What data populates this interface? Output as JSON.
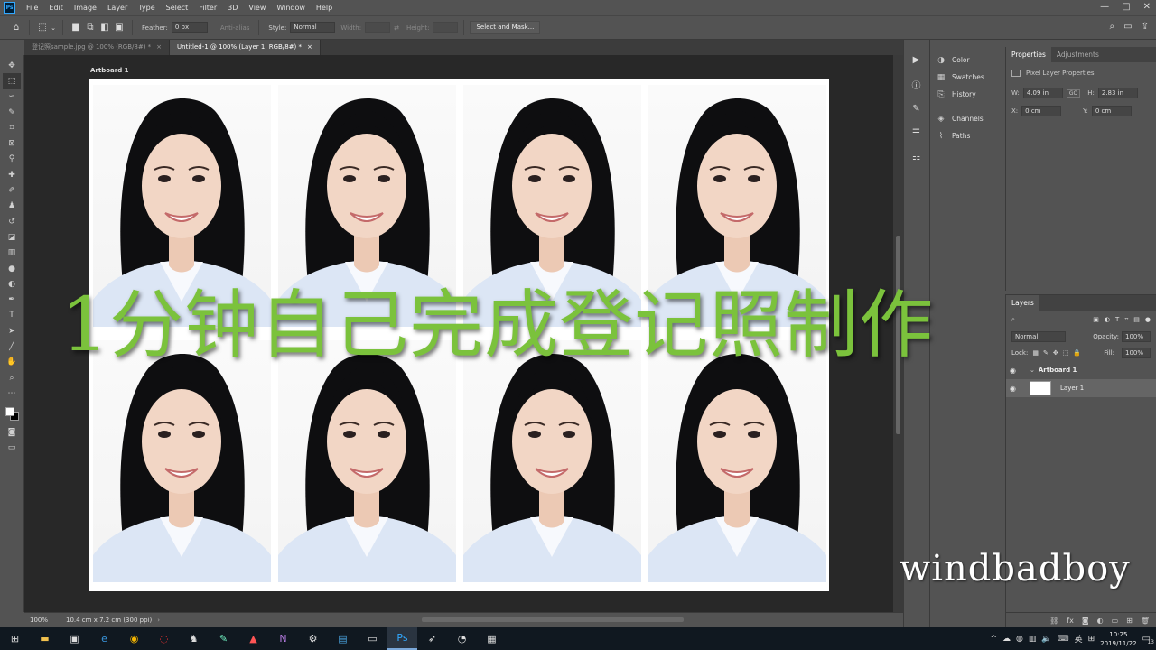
{
  "menubar": {
    "logo": "Ps",
    "items": [
      "File",
      "Edit",
      "Image",
      "Layer",
      "Type",
      "Select",
      "Filter",
      "3D",
      "View",
      "Window",
      "Help"
    ]
  },
  "options": {
    "feather_label": "Feather:",
    "feather_value": "0 px",
    "antialias_label": "Anti-alias",
    "style_label": "Style:",
    "style_value": "Normal",
    "width_label": "Width:",
    "height_label": "Height:",
    "select_mask_button": "Select and Mask..."
  },
  "tabs": [
    {
      "label": "登记照sample.jpg @ 100% (RGB/8#) *",
      "active": false
    },
    {
      "label": "Untitled-1 @ 100% (Layer 1, RGB/8#) *",
      "active": true
    }
  ],
  "canvas": {
    "artboard_label": "Artboard 1",
    "photo_count": 8
  },
  "status": {
    "zoom": "100%",
    "doc_info": "10.4 cm x 7.2 cm (300 ppi)"
  },
  "collapsed_panels": [
    {
      "label": "Color",
      "icon": "color-wheel-icon"
    },
    {
      "label": "Swatches",
      "icon": "grid-icon"
    },
    {
      "label": "History",
      "icon": "history-icon"
    },
    {
      "label": "Channels",
      "icon": "channels-icon"
    },
    {
      "label": "Paths",
      "icon": "paths-icon"
    }
  ],
  "properties": {
    "tab_properties": "Properties",
    "tab_adjustments": "Adjustments",
    "section_title": "Pixel Layer Properties",
    "w_label": "W:",
    "w_value": "4.09 in",
    "link_label": "GO",
    "h_label": "H:",
    "h_value": "2.83 in",
    "x_label": "X:",
    "x_value": "0 cm",
    "y_label": "Y:",
    "y_value": "0 cm"
  },
  "layers": {
    "tab_label": "Layers",
    "blend_mode": "Normal",
    "opacity_label": "Opacity:",
    "opacity_value": "100%",
    "lock_label": "Lock:",
    "fill_label": "Fill:",
    "fill_value": "100%",
    "artboard_row": "Artboard 1",
    "layer_row": "Layer 1"
  },
  "overlay": {
    "title": "1分钟自己完成登记照制作",
    "watermark": "windbadboy"
  },
  "taskbar": {
    "time": "10:25",
    "date": "2019/11/22",
    "lang": "英",
    "notif_count": "13"
  },
  "colors": {
    "overlay_green": "#7bc23c",
    "ps_blue": "#31a8ff",
    "ui_gray": "#535353"
  }
}
